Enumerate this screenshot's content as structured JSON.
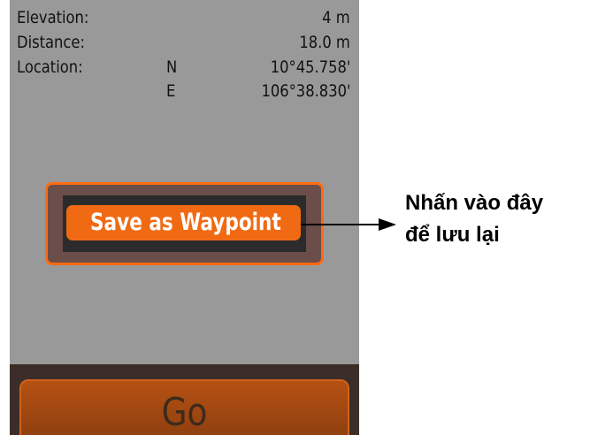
{
  "info": {
    "elevation": {
      "label": "Elevation:",
      "value": "4 m"
    },
    "distance": {
      "label": "Distance:",
      "value": "18.0 m"
    },
    "location": {
      "label": "Location:",
      "lat_dir": "N",
      "lat": "10°45.758'",
      "lon_dir": "E",
      "lon": "106°38.830'"
    }
  },
  "buttons": {
    "save_label": "Save as Waypoint",
    "go_label": "Go"
  },
  "callout": {
    "line1": "Nhấn vào đây",
    "line2": "để lưu lại"
  },
  "colors": {
    "screen_bg": "#999999",
    "accent": "#f06a14",
    "callout_text": "#000000"
  }
}
